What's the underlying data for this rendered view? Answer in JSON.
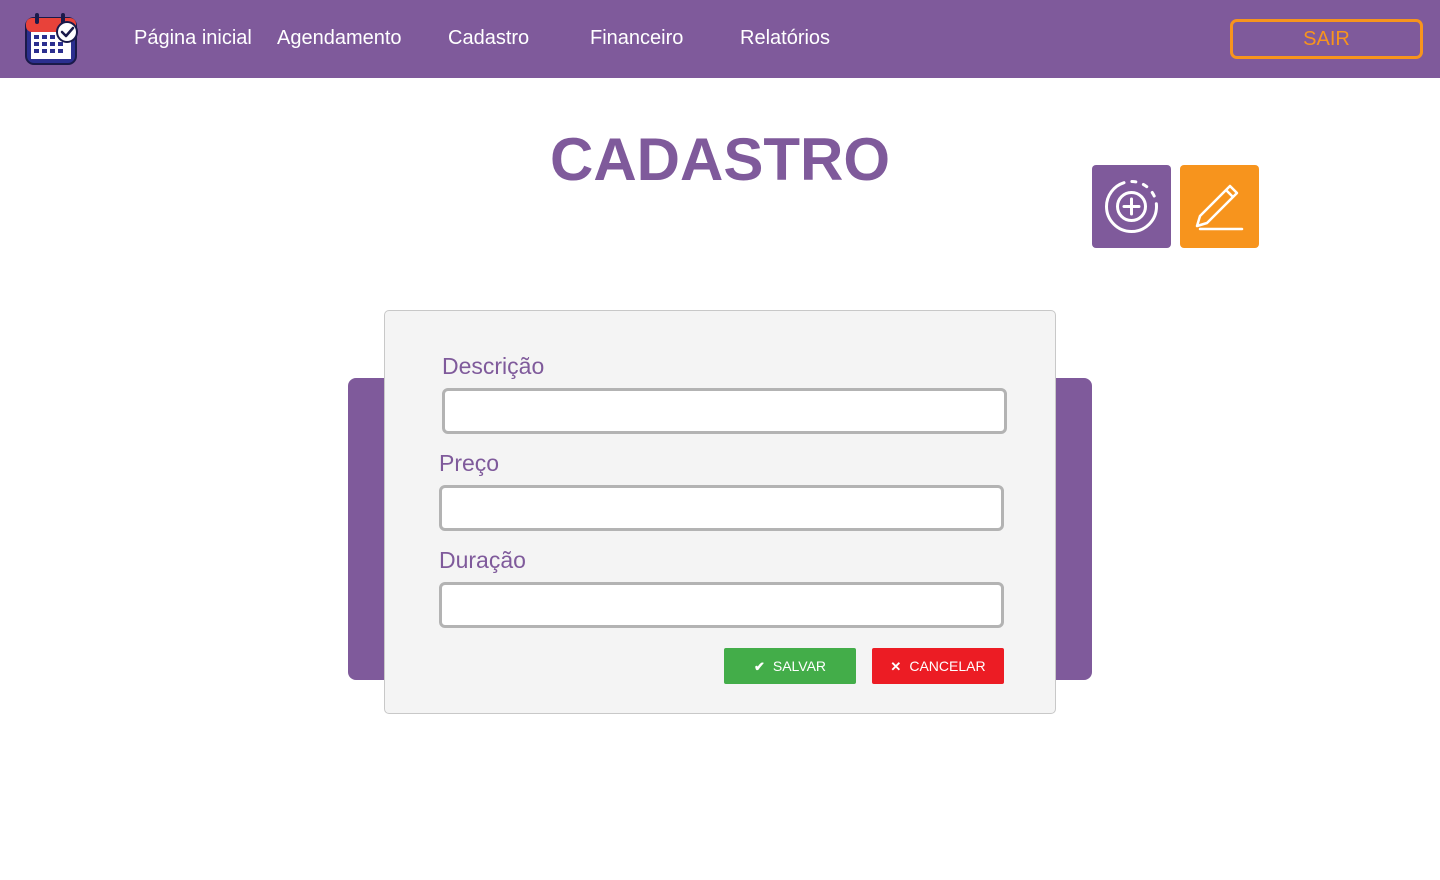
{
  "app": {
    "logo_icon": "calendar-check-icon"
  },
  "nav": {
    "items": [
      {
        "label": "Página inicial"
      },
      {
        "label": "Agendamento"
      },
      {
        "label": "Cadastro"
      },
      {
        "label": "Financeiro"
      },
      {
        "label": "Relatórios"
      }
    ],
    "logout_label": "SAIR"
  },
  "page": {
    "title": "CADASTRO"
  },
  "toolbar": {
    "add_icon": "plus-circle-icon",
    "edit_icon": "pencil-icon"
  },
  "form": {
    "fields": [
      {
        "label": "Descrição",
        "value": ""
      },
      {
        "label": "Preço",
        "value": ""
      },
      {
        "label": "Duração",
        "value": ""
      }
    ],
    "save_label": "SALVAR",
    "save_icon": "check-icon",
    "cancel_label": "CANCELAR",
    "cancel_icon": "close-icon"
  },
  "colors": {
    "brand_purple": "#7f5a9b",
    "accent_orange": "#f7941d",
    "save_green": "#43ad49",
    "cancel_red": "#ec1c24"
  }
}
